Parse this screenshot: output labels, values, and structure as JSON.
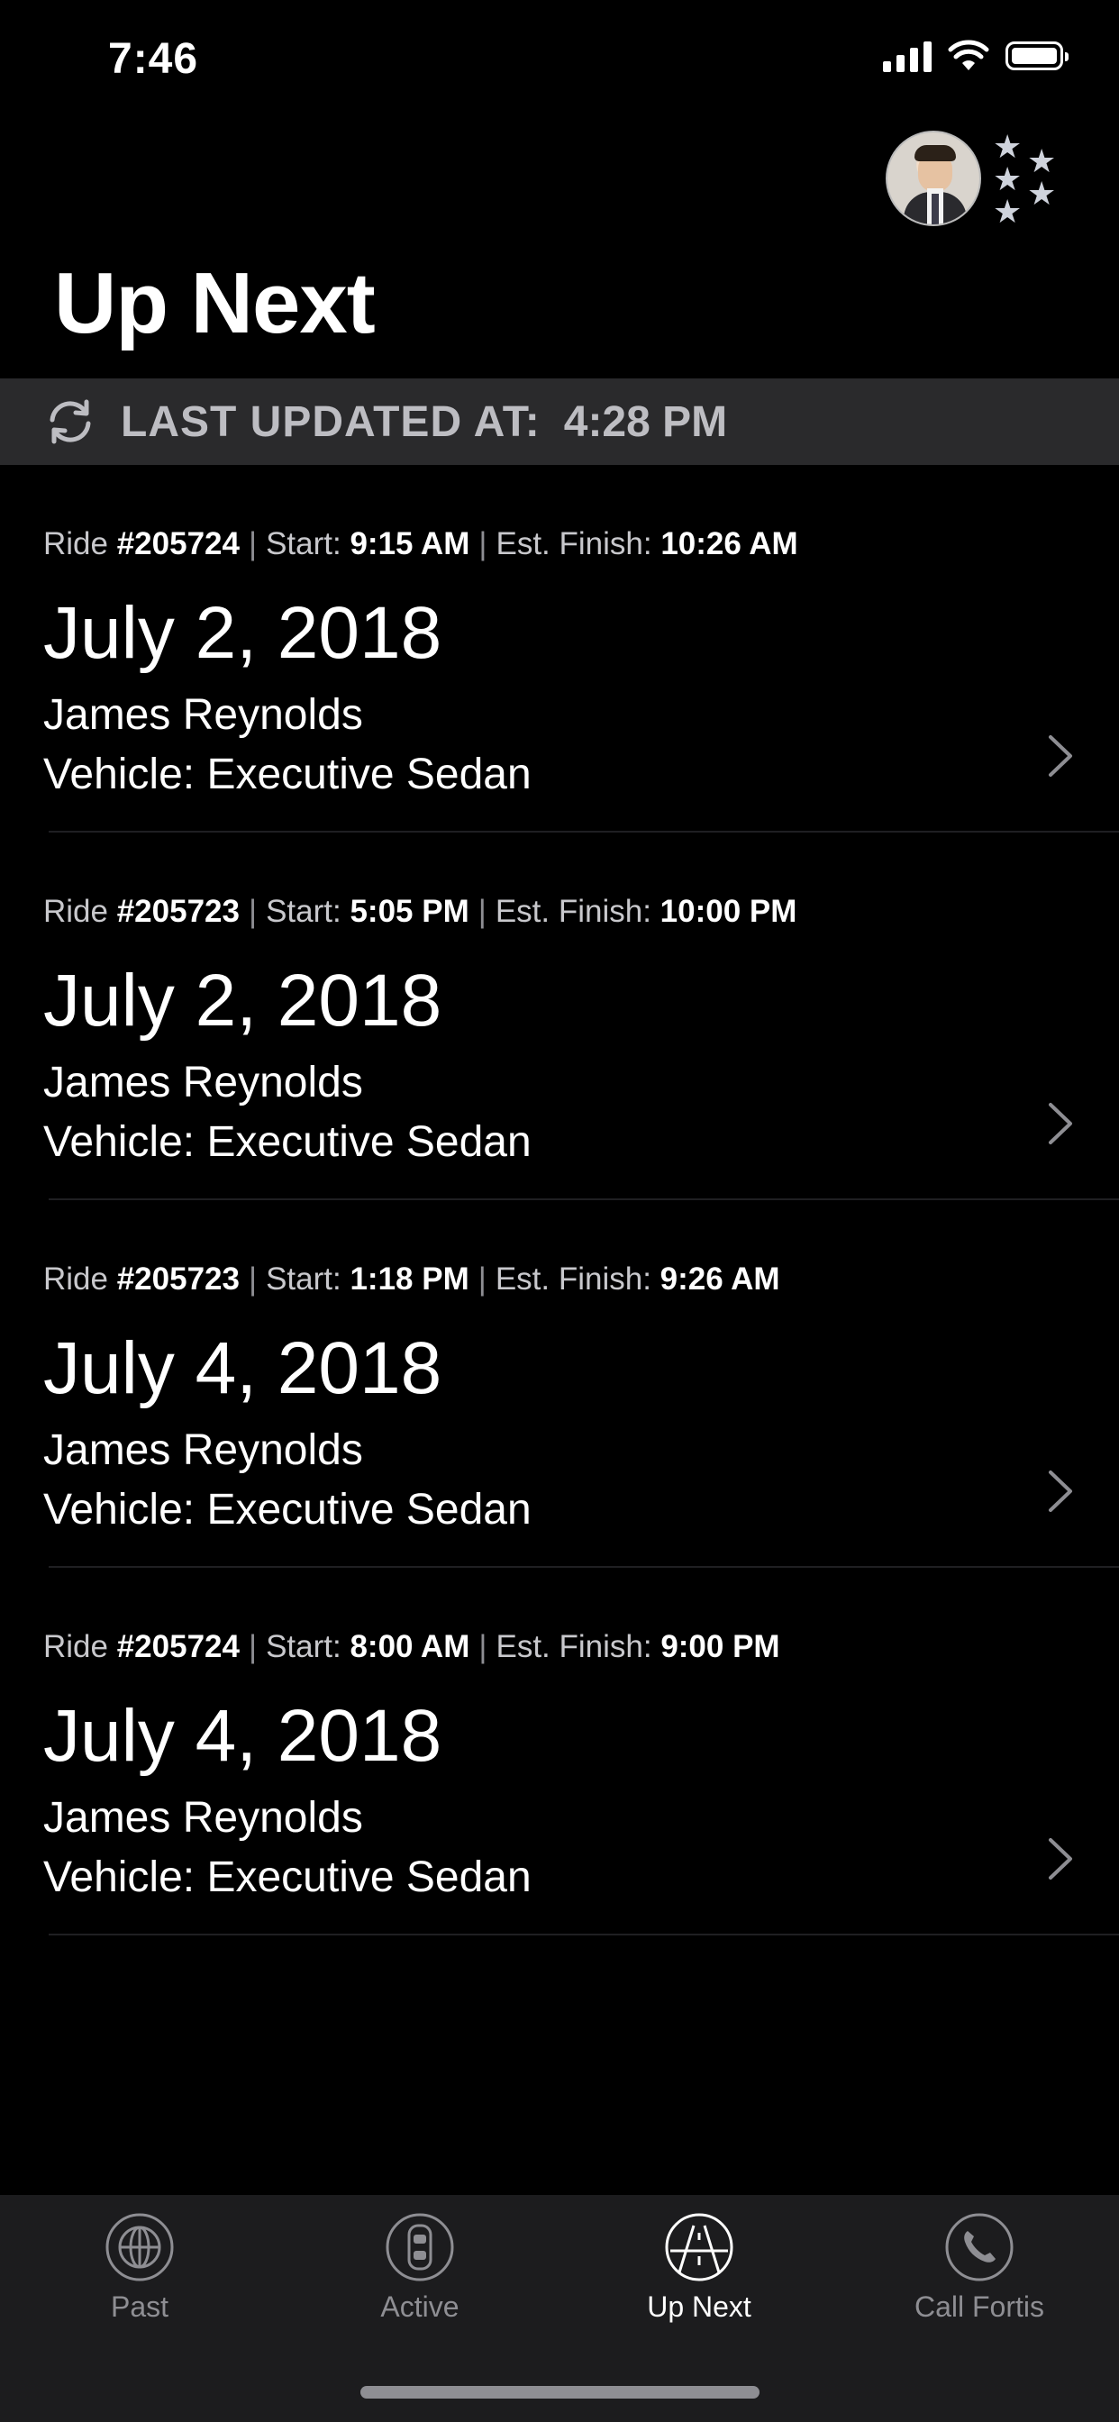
{
  "status_bar": {
    "time": "7:46"
  },
  "header": {
    "title": "Up Next",
    "avatar_icon": "profile-photo",
    "rating_icon": "stars-icon"
  },
  "updated_bar": {
    "label": "LAST UPDATED AT:",
    "time": "4:28 PM"
  },
  "rides": [
    {
      "ride_label": "Ride",
      "ride_no": "#205724",
      "start_label": "Start:",
      "start": "9:15 AM",
      "finish_label": "Est. Finish:",
      "finish": "10:26 AM",
      "date": "July 2, 2018",
      "name": "James Reynolds",
      "vehicle": "Vehicle: Executive Sedan"
    },
    {
      "ride_label": "Ride",
      "ride_no": "#205723",
      "start_label": "Start:",
      "start": "5:05 PM",
      "finish_label": "Est. Finish:",
      "finish": "10:00 PM",
      "date": "July 2, 2018",
      "name": "James Reynolds",
      "vehicle": "Vehicle: Executive Sedan"
    },
    {
      "ride_label": "Ride",
      "ride_no": "#205723",
      "start_label": "Start:",
      "start": "1:18 PM",
      "finish_label": "Est. Finish:",
      "finish": "9:26 AM",
      "date": "July 4, 2018",
      "name": "James Reynolds",
      "vehicle": "Vehicle: Executive Sedan"
    },
    {
      "ride_label": "Ride",
      "ride_no": "#205724",
      "start_label": "Start:",
      "start": "8:00 AM",
      "finish_label": "Est. Finish:",
      "finish": "9:00 PM",
      "date": "July 4, 2018",
      "name": "James Reynolds",
      "vehicle": "Vehicle: Executive Sedan"
    }
  ],
  "tabs": [
    {
      "label": "Past",
      "icon": "globe-icon",
      "active": false
    },
    {
      "label": "Active",
      "icon": "car-icon",
      "active": false
    },
    {
      "label": "Up Next",
      "icon": "road-icon",
      "active": true
    },
    {
      "label": "Call Fortis",
      "icon": "phone-icon",
      "active": false
    }
  ],
  "colors": {
    "background": "#000000",
    "updated_bar": "#2a2a2c",
    "tab_bar": "#1c1c1e",
    "inactive_tab": "#8e8e93",
    "active_tab": "#ffffff"
  }
}
